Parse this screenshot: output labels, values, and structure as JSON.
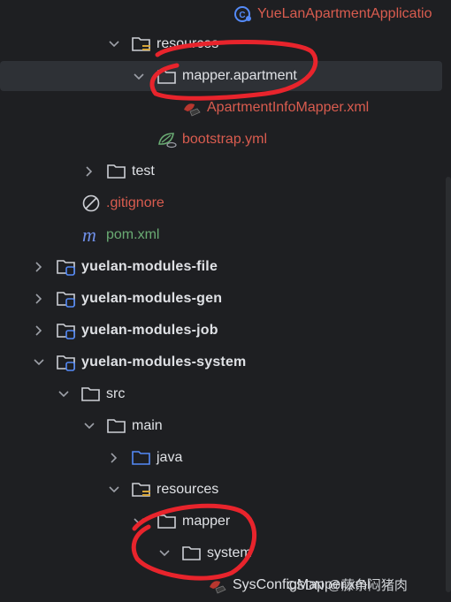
{
  "tree": {
    "app_class": "YueLanApartmentApplicatio",
    "resources_top": "resources",
    "mapper_apartment": "mapper.apartment",
    "apartment_mapper_xml": "ApartmentInfoMapper.xml",
    "bootstrap_yml": "bootstrap.yml",
    "test": "test",
    "gitignore": ".gitignore",
    "pom": "pom.xml",
    "mod_file": "yuelan-modules-file",
    "mod_gen": "yuelan-modules-gen",
    "mod_job": "yuelan-modules-job",
    "mod_system": "yuelan-modules-system",
    "src": "src",
    "main": "main",
    "java": "java",
    "resources": "resources",
    "mapper": "mapper",
    "system": "system",
    "sys_config_mapper": "SysConfigMapper.xml"
  },
  "watermark": "CSDN @藤条闷猪肉",
  "colors": {
    "background": "#1e1f22",
    "selection": "#2e3136",
    "error_text": "#d95c4f",
    "ignored_text": "#6aab73",
    "annotation": "#e8242c",
    "folder_blue": "#548af7"
  },
  "icons": [
    "class-icon",
    "folder-icon",
    "resources-folder-icon",
    "xml-mapper-icon",
    "spring-yml-icon",
    "ignore-file-icon",
    "maven-icon",
    "module-icon",
    "source-folder-icon",
    "chevron-right-icon",
    "chevron-down-icon"
  ]
}
